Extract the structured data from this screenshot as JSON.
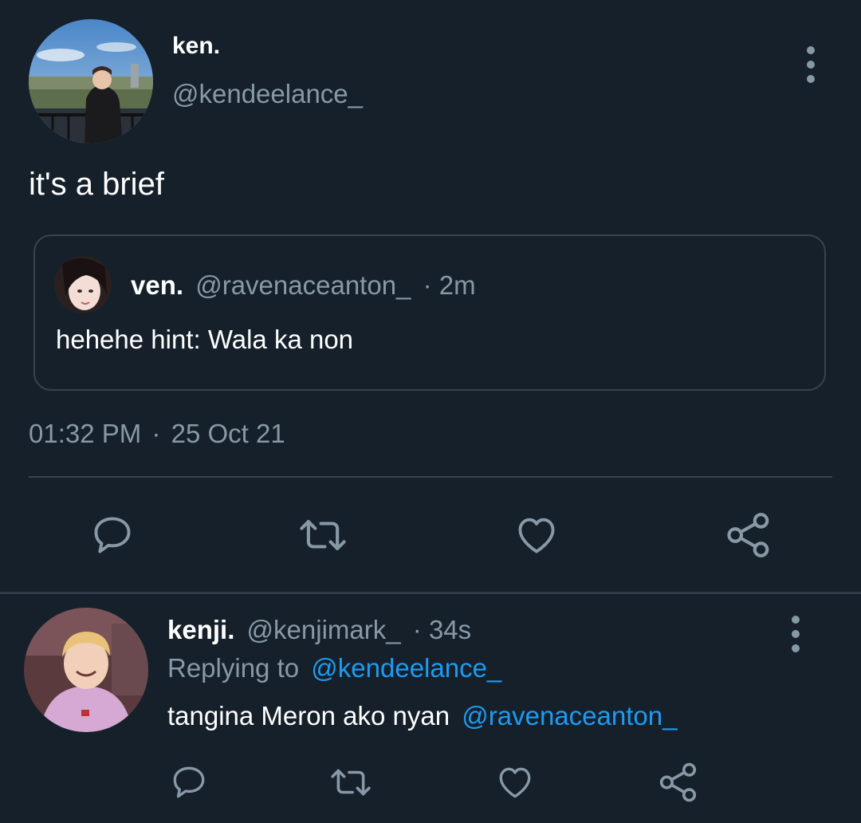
{
  "colors": {
    "background": "#15202b",
    "muted": "#8899a6",
    "link": "#1d9bf0",
    "divider": "#38444d"
  },
  "tweet": {
    "author": {
      "display_name": "ken.",
      "handle": "@kendeelance_"
    },
    "text": "it's a brief",
    "quote": {
      "display_name": "ven.",
      "handle": "@ravenaceanton_",
      "separator": "·",
      "time": "2m",
      "text": "hehehe hint: Wala ka non"
    },
    "timestamp": {
      "time": "01:32 PM",
      "separator": "·",
      "date": "25 Oct 21"
    },
    "actions": [
      "reply-icon",
      "retweet-icon",
      "like-icon",
      "share-icon"
    ]
  },
  "reply": {
    "author": {
      "display_name": "kenji.",
      "handle": "@kenjimark_",
      "separator": "·",
      "time": "34s"
    },
    "replying_to": {
      "prefix": "Replying to",
      "handle": "@kendeelance_"
    },
    "text": {
      "body": "tangina Meron ako nyan",
      "mention": "@ravenaceanton_"
    },
    "actions": [
      "reply-icon",
      "retweet-icon",
      "like-icon",
      "share-icon"
    ]
  }
}
